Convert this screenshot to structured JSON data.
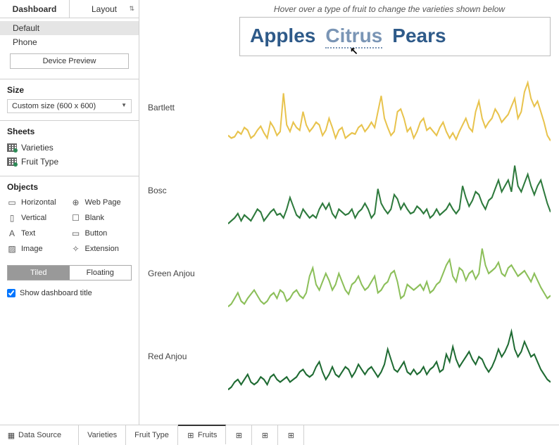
{
  "left_panel": {
    "tabs": {
      "dashboard": "Dashboard",
      "layout": "Layout"
    },
    "devices": {
      "default": "Default",
      "phone": "Phone"
    },
    "device_preview": "Device Preview",
    "size": {
      "heading": "Size",
      "value": "Custom size (600 x 600)"
    },
    "sheets": {
      "heading": "Sheets",
      "items": [
        "Varieties",
        "Fruit Type"
      ]
    },
    "objects": {
      "heading": "Objects",
      "items": [
        {
          "label": "Horizontal",
          "icon": "▭"
        },
        {
          "label": "Web Page",
          "icon": "⊕"
        },
        {
          "label": "Vertical",
          "icon": "▯"
        },
        {
          "label": "Blank",
          "icon": "☐"
        },
        {
          "label": "Text",
          "icon": "A"
        },
        {
          "label": "Button",
          "icon": "▭"
        },
        {
          "label": "Image",
          "icon": "▨"
        },
        {
          "label": "Extension",
          "icon": "✧"
        }
      ]
    },
    "toggle": {
      "tiled": "Tiled",
      "floating": "Floating"
    },
    "show_title": "Show dashboard title"
  },
  "canvas": {
    "hint": "Hover over a type of fruit to change the varieties shown below",
    "fruit_types": [
      "Apples",
      "Citrus",
      "Pears"
    ],
    "hovered_index": 1
  },
  "bottom_bar": {
    "data_source": "Data Source",
    "tabs": [
      "Varieties",
      "Fruit Type",
      "Fruits"
    ],
    "active_tab": 2
  },
  "chart_data": [
    {
      "type": "line",
      "label": "Bartlett",
      "color": "#e8c34d",
      "values": [
        42,
        40,
        41,
        45,
        43,
        48,
        46,
        40,
        42,
        46,
        49,
        44,
        40,
        52,
        48,
        42,
        45,
        74,
        50,
        45,
        52,
        48,
        46,
        60,
        50,
        45,
        48,
        52,
        50,
        42,
        46,
        55,
        48,
        40,
        46,
        48,
        40,
        42,
        44,
        43,
        48,
        50,
        45,
        48,
        52,
        48,
        60,
        72,
        55,
        48,
        42,
        45,
        60,
        62,
        55,
        45,
        48,
        40,
        45,
        52,
        55,
        46,
        48,
        45,
        42,
        48,
        52,
        45,
        40,
        44,
        39,
        45,
        50,
        55,
        48,
        45,
        60,
        68,
        55,
        48,
        52,
        55,
        62,
        58,
        52,
        55,
        58,
        64,
        70,
        55,
        60,
        75,
        82,
        70,
        64,
        68,
        60,
        52,
        42,
        38
      ]
    },
    {
      "type": "line",
      "label": "Bosc",
      "color": "#2e7a3d",
      "values": [
        38,
        40,
        42,
        45,
        40,
        44,
        42,
        40,
        44,
        48,
        46,
        40,
        43,
        46,
        48,
        44,
        45,
        42,
        48,
        56,
        50,
        44,
        42,
        48,
        45,
        42,
        44,
        42,
        48,
        52,
        48,
        52,
        45,
        42,
        48,
        46,
        44,
        45,
        48,
        42,
        46,
        48,
        52,
        48,
        42,
        45,
        62,
        52,
        48,
        45,
        48,
        58,
        55,
        48,
        52,
        48,
        45,
        46,
        50,
        48,
        45,
        48,
        42,
        44,
        48,
        44,
        46,
        48,
        52,
        48,
        45,
        48,
        64,
        56,
        50,
        54,
        60,
        58,
        52,
        48,
        54,
        56,
        62,
        68,
        60,
        64,
        68,
        60,
        78,
        64,
        60,
        66,
        72,
        64,
        58,
        64,
        68,
        60,
        52,
        46
      ]
    },
    {
      "type": "line",
      "label": "Green Anjou",
      "color": "#8cbf5a",
      "values": [
        36,
        38,
        42,
        46,
        40,
        38,
        42,
        45,
        48,
        44,
        40,
        38,
        40,
        44,
        46,
        42,
        48,
        46,
        40,
        42,
        46,
        48,
        44,
        42,
        46,
        58,
        64,
        52,
        48,
        54,
        60,
        55,
        48,
        52,
        60,
        54,
        48,
        45,
        52,
        54,
        58,
        52,
        48,
        50,
        54,
        58,
        46,
        48,
        52,
        54,
        60,
        62,
        54,
        42,
        44,
        52,
        50,
        48,
        50,
        52,
        48,
        54,
        46,
        48,
        52,
        54,
        60,
        66,
        70,
        58,
        54,
        64,
        62,
        55,
        60,
        62,
        56,
        60,
        78,
        66,
        60,
        62,
        64,
        68,
        60,
        58,
        64,
        66,
        62,
        58,
        60,
        62,
        58,
        54,
        60,
        55,
        50,
        46,
        42,
        44
      ]
    },
    {
      "type": "line",
      "label": "Red Anjou",
      "color": "#1f6b33",
      "values": [
        34,
        36,
        40,
        42,
        38,
        42,
        46,
        40,
        38,
        40,
        44,
        42,
        38,
        44,
        46,
        42,
        40,
        42,
        44,
        40,
        42,
        44,
        48,
        50,
        46,
        44,
        46,
        52,
        56,
        48,
        42,
        46,
        52,
        46,
        44,
        48,
        52,
        50,
        44,
        48,
        54,
        50,
        46,
        50,
        52,
        48,
        44,
        48,
        54,
        66,
        58,
        50,
        48,
        52,
        56,
        48,
        46,
        50,
        46,
        48,
        52,
        46,
        50,
        52,
        56,
        48,
        50,
        62,
        56,
        68,
        58,
        52,
        56,
        60,
        64,
        58,
        54,
        60,
        58,
        52,
        48,
        52,
        58,
        66,
        60,
        64,
        70,
        80,
        66,
        60,
        64,
        72,
        66,
        60,
        62,
        56,
        50,
        46,
        42,
        40
      ]
    }
  ]
}
